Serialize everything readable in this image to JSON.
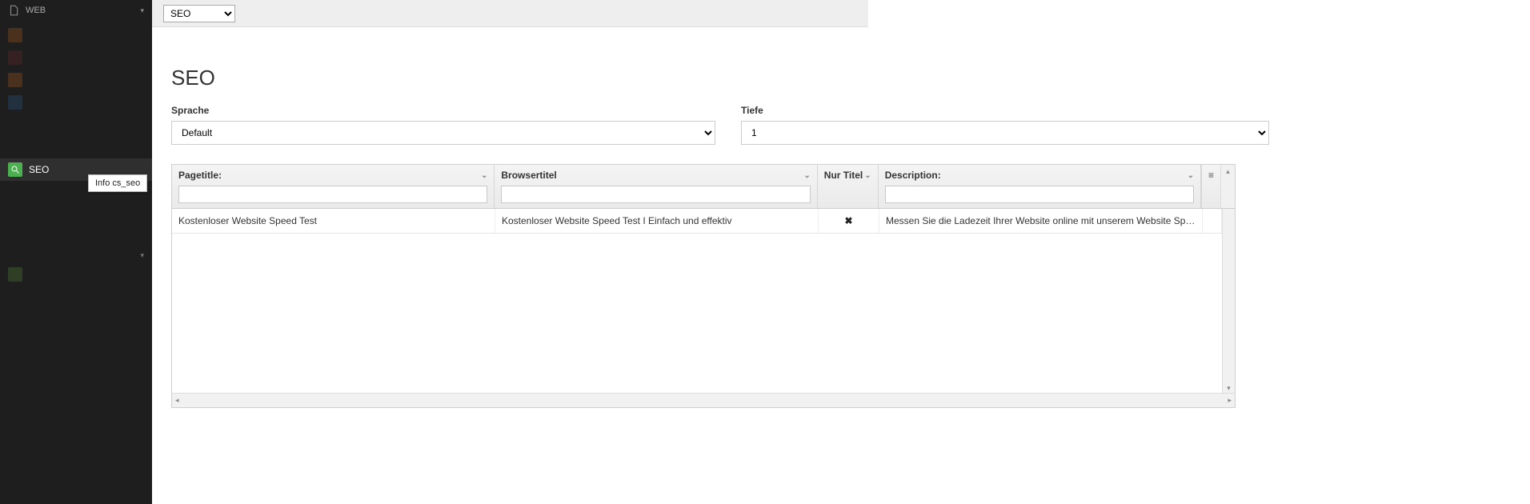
{
  "sidebar": {
    "section_label": "WEB",
    "active_label": "SEO",
    "tooltip": "Info cs_seo"
  },
  "docheader": {
    "module_select": "SEO"
  },
  "page": {
    "title": "SEO"
  },
  "filters": {
    "language_label": "Sprache",
    "language_value": "Default",
    "depth_label": "Tiefe",
    "depth_value": "1"
  },
  "grid": {
    "headers": {
      "pagetitle": "Pagetitle:",
      "browsertitle": "Browsertitel",
      "only_title": "Nur Titel",
      "description": "Description:"
    },
    "rows": [
      {
        "pagetitle": "Kostenloser Website Speed Test",
        "browsertitle": "Kostenloser Website Speed Test I Einfach und effektiv",
        "only_title_mark": "✖",
        "description": "Messen Sie die Ladezeit Ihrer Website online mit unserem Website Speed ..."
      }
    ]
  }
}
